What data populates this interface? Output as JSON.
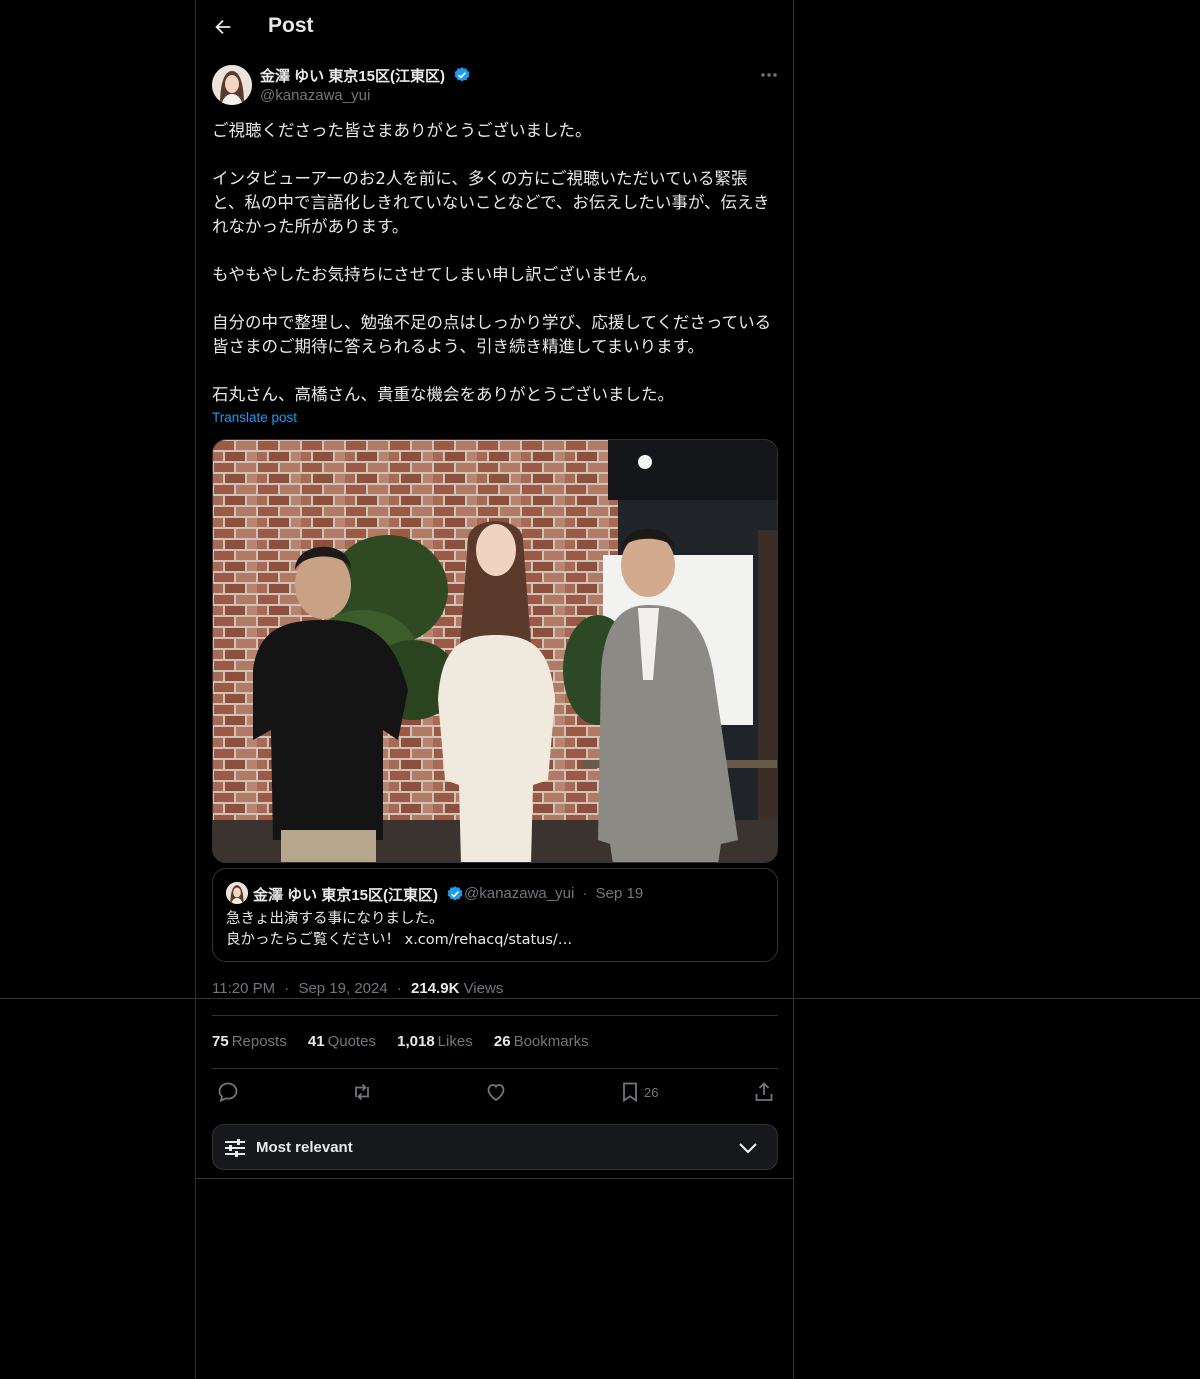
{
  "header": {
    "title": "Post",
    "back_icon": "arrow-left-icon"
  },
  "post": {
    "author": {
      "name": "金澤 ゆい 東京15区(江東区)",
      "handle": "@kanazawa_yui",
      "verified": true
    },
    "text": "ご視聴くださった皆さまありがとうございました。\n\nインタビューアーのお2人を前に、多くの方にご視聴いただいている緊張と、私の中で言語化しきれていないことなどで、お伝えしたい事が、伝えきれなかった所があります。\n\nもやもやしたお気持ちにさせてしまい申し訳ございません。\n\n自分の中で整理し、勉強不足の点はしっかり学び、応援してくださっている皆さまのご期待に答えられるよう、引き続き精進してまいります。\n\n石丸さん、高橋さん、貴重な機会をありがとうございました。",
    "translate_label": "Translate post",
    "quote": {
      "name": "金澤 ゆい 東京15区(江東区)",
      "handle": "@kanazawa_yui",
      "sep": "·",
      "date": "Sep 19",
      "text": "急きょ出演する事になりました。\n良かったらご覧ください！ x.com/rehacq/status/…"
    },
    "time": "11:20 PM",
    "date": "Sep 19, 2024",
    "dot": "·",
    "views_count": "214.9K",
    "views_label": "Views",
    "stats": {
      "reposts": {
        "count": "75",
        "label": "Reposts"
      },
      "quotes": {
        "count": "41",
        "label": "Quotes"
      },
      "likes": {
        "count": "1,018",
        "label": "Likes"
      },
      "bookmarks": {
        "count": "26",
        "label": "Bookmarks"
      }
    },
    "actions": {
      "bookmark_count": "26"
    },
    "sort": {
      "label": "Most relevant"
    }
  },
  "colors": {
    "background": "#000000",
    "text": "#e7e9ea",
    "muted": "#71767b",
    "accent": "#1d9bf0",
    "border": "#2f3336"
  }
}
